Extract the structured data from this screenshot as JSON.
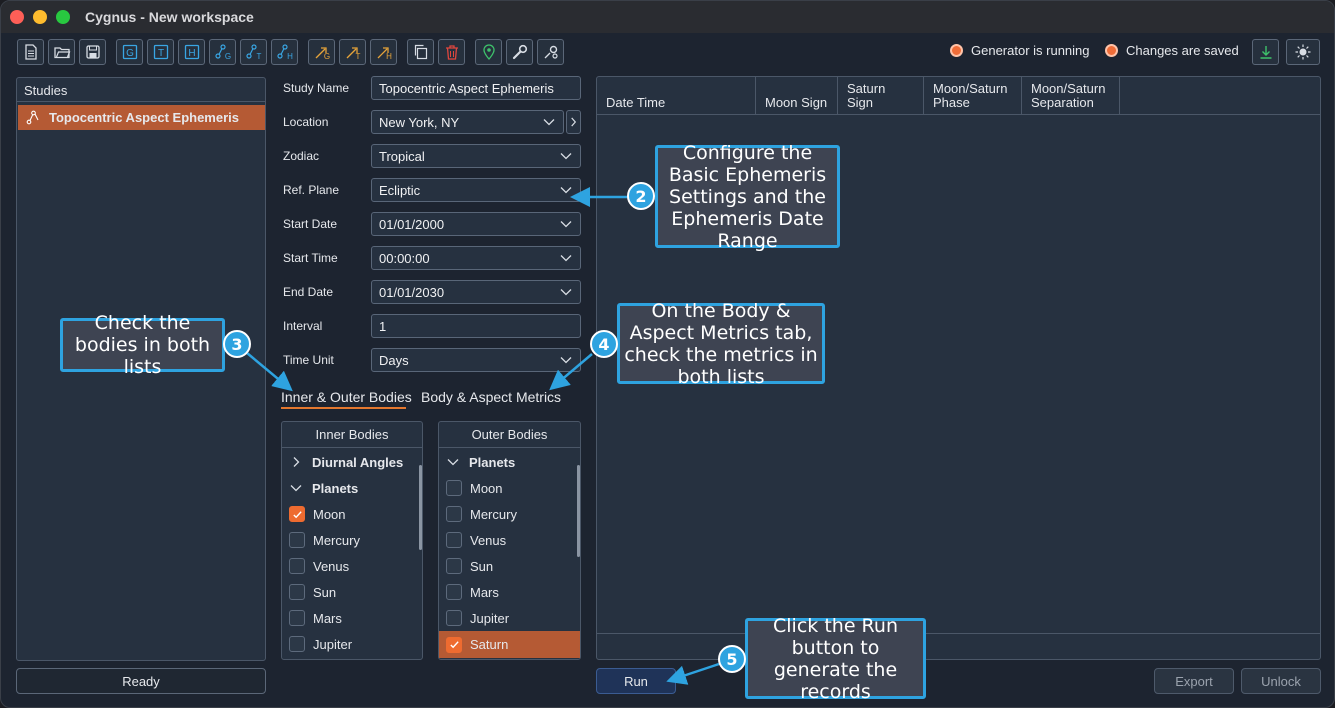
{
  "window": {
    "title": "Cygnus - New workspace"
  },
  "toolbar": {
    "buttons": [
      {
        "icon": "new-document-icon"
      },
      {
        "icon": "open-folder-icon"
      },
      {
        "icon": "save-icon"
      },
      {
        "icon": "g-box-icon",
        "text": "G"
      },
      {
        "icon": "t-box-icon",
        "text": "T"
      },
      {
        "icon": "h-box-icon",
        "text": "H"
      },
      {
        "icon": "aspect-g-icon",
        "text": "G"
      },
      {
        "icon": "aspect-t-icon",
        "text": "T"
      },
      {
        "icon": "aspect-h-icon",
        "text": "H"
      },
      {
        "icon": "transit-g-icon",
        "text": "G"
      },
      {
        "icon": "transit-t-icon",
        "text": "T"
      },
      {
        "icon": "transit-h-icon",
        "text": "H"
      },
      {
        "icon": "copy-icon"
      },
      {
        "icon": "trash-icon"
      },
      {
        "icon": "location-pin-icon"
      },
      {
        "icon": "wrench-icon"
      },
      {
        "icon": "settings-node-icon"
      }
    ],
    "status_generator": "Generator is running",
    "status_saved": "Changes are saved"
  },
  "studies": {
    "header": "Studies",
    "items": [
      {
        "label": "Topocentric Aspect Ephemeris"
      }
    ],
    "status": "Ready"
  },
  "form": {
    "study_name_label": "Study Name",
    "study_name_value": "Topocentric Aspect Ephemeris",
    "location_label": "Location",
    "location_value": "New York, NY",
    "zodiac_label": "Zodiac",
    "zodiac_value": "Tropical",
    "ref_plane_label": "Ref. Plane",
    "ref_plane_value": "Ecliptic",
    "start_date_label": "Start Date",
    "start_date_value": "01/01/2000",
    "start_time_label": "Start Time",
    "start_time_value": "00:00:00",
    "end_date_label": "End Date",
    "end_date_value": "01/01/2030",
    "interval_label": "Interval",
    "interval_value": "1",
    "time_unit_label": "Time Unit",
    "time_unit_value": "Days"
  },
  "tabs": [
    {
      "label": "Inner & Outer Bodies",
      "active": true
    },
    {
      "label": "Body & Aspect Metrics",
      "active": false
    }
  ],
  "inner_bodies": {
    "header": "Inner Bodies",
    "groups": [
      {
        "label": "Diurnal Angles",
        "expanded": false
      },
      {
        "label": "Planets",
        "expanded": true
      }
    ],
    "items": [
      {
        "label": "Moon",
        "checked": true
      },
      {
        "label": "Mercury",
        "checked": false
      },
      {
        "label": "Venus",
        "checked": false
      },
      {
        "label": "Sun",
        "checked": false
      },
      {
        "label": "Mars",
        "checked": false
      },
      {
        "label": "Jupiter",
        "checked": false
      }
    ]
  },
  "outer_bodies": {
    "header": "Outer Bodies",
    "groups": [
      {
        "label": "Planets",
        "expanded": true
      }
    ],
    "items": [
      {
        "label": "Moon",
        "checked": false
      },
      {
        "label": "Mercury",
        "checked": false
      },
      {
        "label": "Venus",
        "checked": false
      },
      {
        "label": "Sun",
        "checked": false
      },
      {
        "label": "Mars",
        "checked": false
      },
      {
        "label": "Jupiter",
        "checked": false
      },
      {
        "label": "Saturn",
        "checked": true
      }
    ]
  },
  "results": {
    "columns": [
      {
        "line1": "",
        "line2": "Date Time"
      },
      {
        "line1": "",
        "line2": "Moon Sign"
      },
      {
        "line1": "",
        "line2": "Saturn Sign"
      },
      {
        "line1": "Moon/Saturn",
        "line2": "Phase"
      },
      {
        "line1": "Moon/Saturn",
        "line2": "Separation"
      }
    ]
  },
  "buttons": {
    "run": "Run",
    "export": "Export",
    "unlock": "Unlock"
  },
  "callouts": {
    "c2": {
      "number": "2",
      "text": "Configure the Basic Ephemeris Settings and the Ephemeris Date Range"
    },
    "c3": {
      "number": "3",
      "text": "Check the bodies in both lists"
    },
    "c4": {
      "number": "4",
      "text": "On the Body & Aspect Metrics tab, check the metrics in both lists"
    },
    "c5": {
      "number": "5",
      "text": "Click the Run button to generate the records"
    }
  },
  "colors": {
    "accent": "#ee6b30",
    "callout_border": "#2ea3e0",
    "selection": "#b55a34",
    "run_button": "#1f3358"
  }
}
